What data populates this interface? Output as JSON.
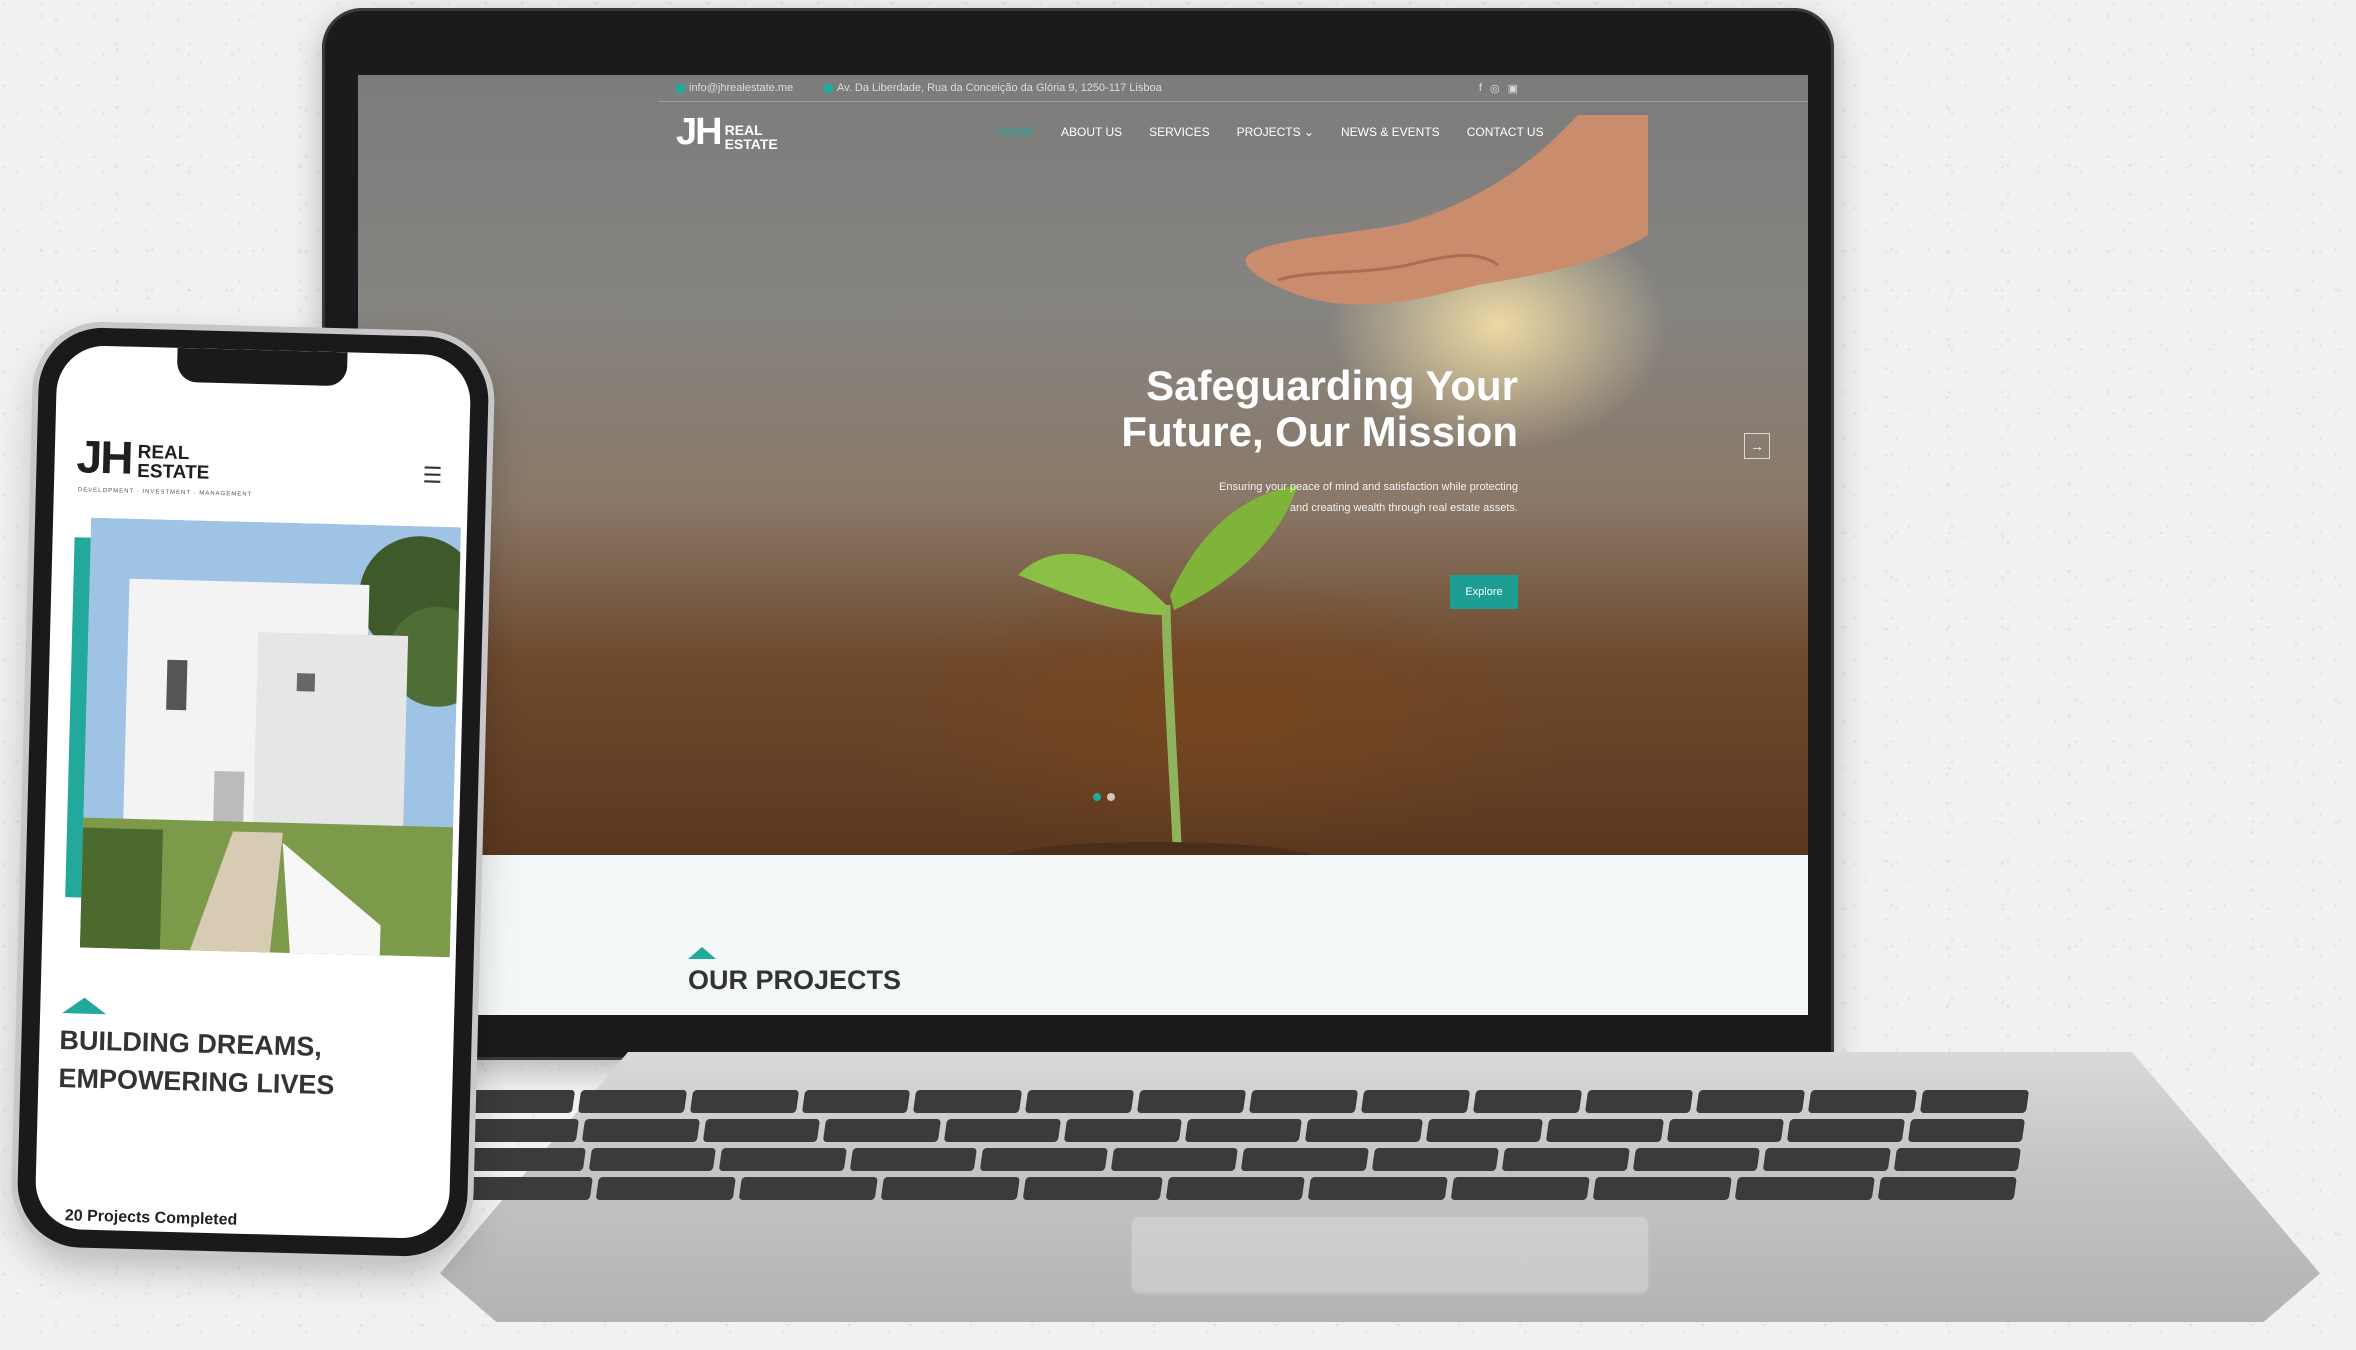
{
  "brand": {
    "logo_mark": "JH",
    "logo_words_1": "REAL",
    "logo_words_2": "ESTATE",
    "tagline": "DEVELOPMENT · INVESTMENT · MANAGEMENT",
    "accent": "#23a99c"
  },
  "topbar": {
    "email": "info@jhrealestate.me",
    "address": "Av. Da Liberdade, Rua da Conceição da Glória 9, 1250-117 Lisboa",
    "socials": [
      "f",
      "◎",
      "▣"
    ]
  },
  "nav": {
    "items": [
      {
        "label": "HOME"
      },
      {
        "label": "ABOUT US"
      },
      {
        "label": "SERVICES"
      },
      {
        "label": "PROJECTS ⌄"
      },
      {
        "label": "NEWS & EVENTS"
      },
      {
        "label": "CONTACT US"
      }
    ]
  },
  "hero": {
    "title_line1": "Safeguarding Your",
    "title_line2": "Future, Our Mission",
    "subtitle_line1": "Ensuring your peace of mind and satisfaction while protecting",
    "subtitle_line2": "and creating wealth through real estate assets.",
    "button": "Explore",
    "next_arrow": "→"
  },
  "projects": {
    "title": "OUR PROJECTS"
  },
  "mobile": {
    "menu_icon": "☰",
    "title_line1": "BUILDING DREAMS,",
    "title_line2": "EMPOWERING LIVES",
    "projects_completed": "20 Projects Completed"
  }
}
